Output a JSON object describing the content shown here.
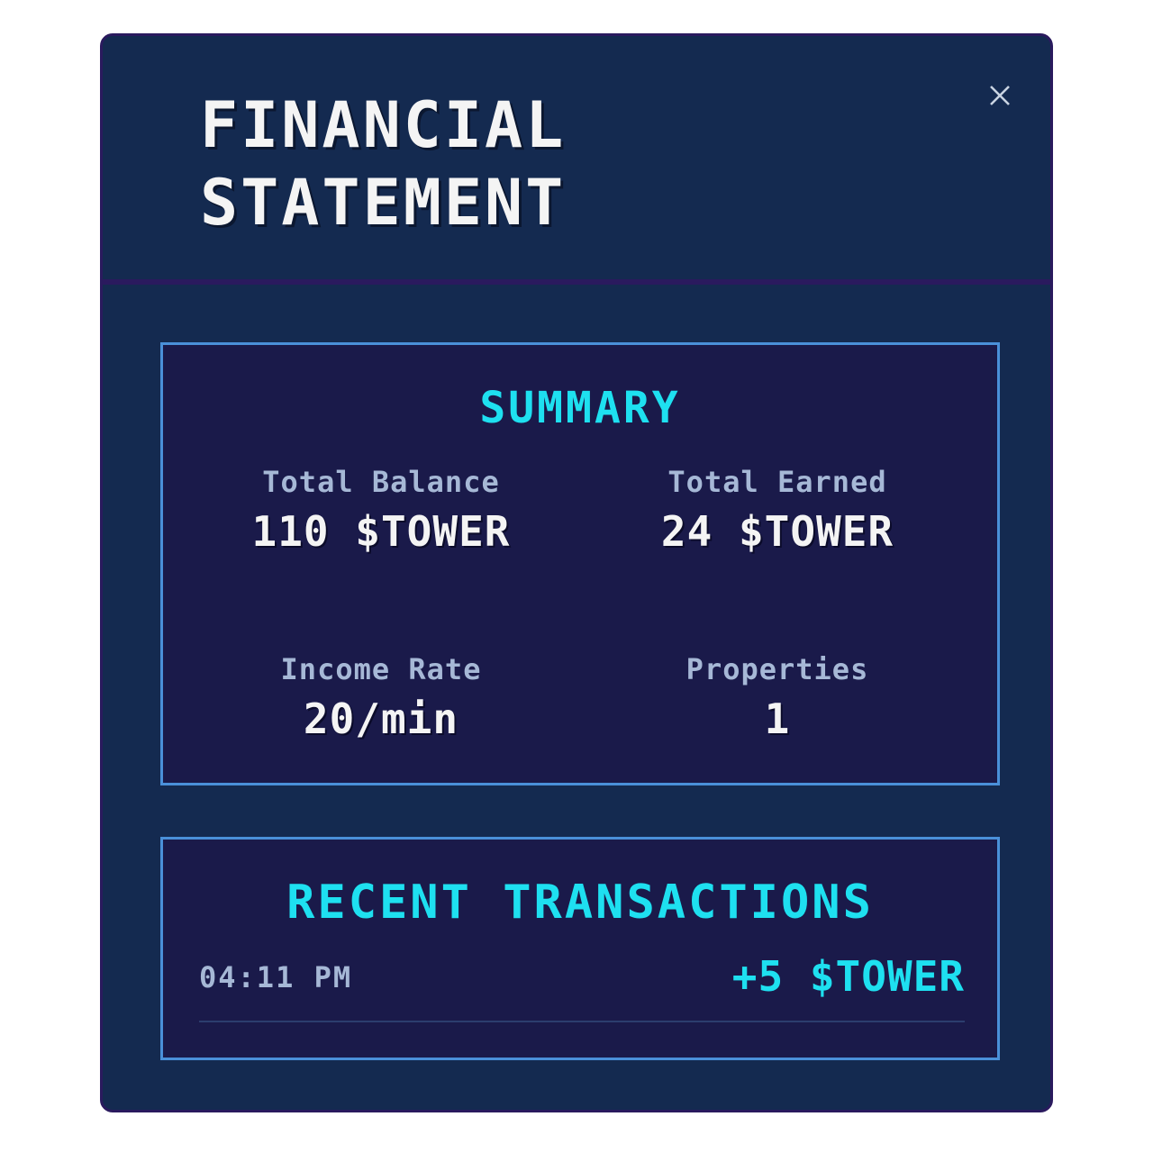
{
  "header": {
    "title": "FINANCIAL STATEMENT",
    "close_icon": "close-icon"
  },
  "summary": {
    "title": "SUMMARY",
    "stats": [
      {
        "label": "Total Balance",
        "value": "110 $TOWER"
      },
      {
        "label": "Total Earned",
        "value": "24 $TOWER"
      },
      {
        "label": "Income Rate",
        "value": "20/min"
      },
      {
        "label": "Properties",
        "value": "1"
      }
    ]
  },
  "transactions": {
    "title": "RECENT TRANSACTIONS",
    "items": [
      {
        "time": "04:11 PM",
        "amount": "+5 $TOWER"
      }
    ]
  },
  "colors": {
    "panel_bg": "#142a50",
    "section_bg": "#1a1a4a",
    "border_accent": "#4a90d9",
    "heading_cyan": "#1ee0f0",
    "label_gray": "#a6b8d6",
    "value_white": "#f4f4f4"
  }
}
